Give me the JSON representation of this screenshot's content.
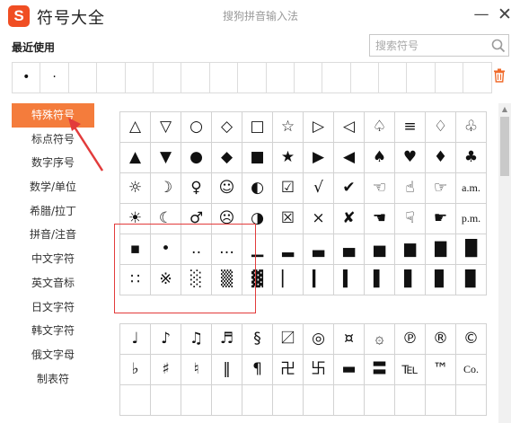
{
  "title_bar": {
    "logo_letter": "S",
    "app_title": "符号大全",
    "window_title": "搜狗拼音输入法",
    "minimize_label": "—",
    "close_label": "✕"
  },
  "recent": {
    "label": "最近使用",
    "items": [
      "•",
      "·",
      "",
      "",
      "",
      "",
      "",
      "",
      "",
      "",
      "",
      "",
      "",
      "",
      "",
      "",
      ""
    ]
  },
  "search": {
    "placeholder": "搜索符号",
    "value": ""
  },
  "sidebar": {
    "items": [
      {
        "label": "特殊符号",
        "active": true
      },
      {
        "label": "标点符号",
        "active": false
      },
      {
        "label": "数字序号",
        "active": false
      },
      {
        "label": "数学/单位",
        "active": false
      },
      {
        "label": "希腊/拉丁",
        "active": false
      },
      {
        "label": "拼音/注音",
        "active": false
      },
      {
        "label": "中文字符",
        "active": false
      },
      {
        "label": "英文音标",
        "active": false
      },
      {
        "label": "日文字符",
        "active": false
      },
      {
        "label": "韩文字符",
        "active": false
      },
      {
        "label": "俄文字母",
        "active": false
      },
      {
        "label": "制表符",
        "active": false
      }
    ]
  },
  "grid_a": [
    [
      "△",
      "▽",
      "○",
      "◇",
      "□",
      "☆",
      "▷",
      "◁",
      "♤",
      "≡",
      "♢",
      "♧"
    ],
    [
      "▲",
      "▼",
      "●",
      "◆",
      "■",
      "★",
      "▶",
      "◀",
      "♠",
      "♥",
      "♦",
      "♣"
    ],
    [
      "☼",
      "☽",
      "♀",
      "☺",
      "◐",
      "☑",
      "√",
      "✔",
      "☜",
      "☝",
      "☞",
      "a.m."
    ],
    [
      "☀",
      "☾",
      "♂",
      "☹",
      "◑",
      "☒",
      "×",
      "✘",
      "☚",
      "☟",
      "☛",
      "p.m."
    ],
    [
      "▪",
      "•",
      "‥",
      "…",
      "▁",
      "▂",
      "▃",
      "▄",
      "▅",
      "▆",
      "▇",
      "█"
    ],
    [
      "∷",
      "※",
      "░",
      "▒",
      "▓",
      "▏",
      "▎",
      "▍",
      "▌",
      "▋",
      "▊",
      "▉"
    ]
  ],
  "grid_b": [
    [
      "♩",
      "♪",
      "♫",
      "♬",
      "§",
      "〼",
      "◎",
      "¤",
      "۞",
      "℗",
      "®",
      "©"
    ],
    [
      "♭",
      "♯",
      "♮",
      "‖",
      "¶",
      "卍",
      "卐",
      "▬",
      "〓",
      "℡",
      "™",
      "Co."
    ],
    [
      "",
      "",
      "",
      "",
      "",
      "",
      "",
      "",
      "",
      "",
      "",
      ""
    ]
  ],
  "colors": {
    "accent": "#f47c3c",
    "logo": "#f04e23",
    "highlight": "#e23b3b",
    "grid_line": "#d2d2d2"
  },
  "icons": {
    "search": "search-icon",
    "trash": "trash-icon",
    "logo": "sogou-logo-icon"
  }
}
